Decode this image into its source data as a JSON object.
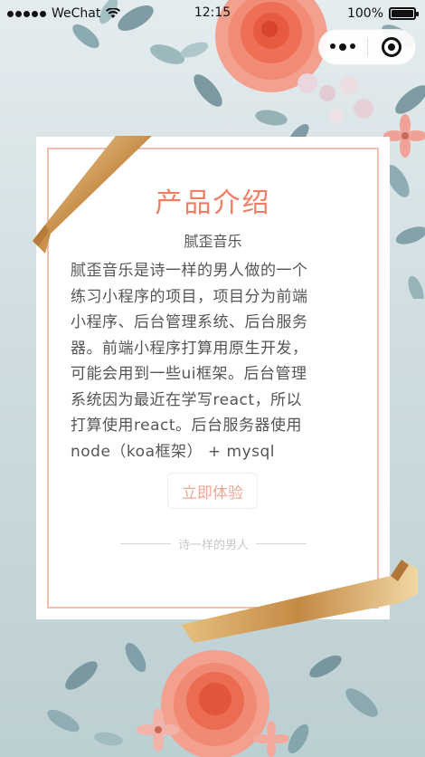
{
  "status_bar": {
    "carrier": "WeChat",
    "time": "12:15",
    "battery": "100%"
  },
  "capsule": {
    "more_icon": "more-dots-icon",
    "close_icon": "close-mini-program-icon"
  },
  "card": {
    "title": "产品介绍",
    "subtitle": "腻歪音乐",
    "body_lines": [
      "腻歪音乐是诗一样的男人做的一个",
      "练习小程序的项目，项目分为前端",
      "小程序、后台管理系统、后台服务",
      "器。前端小程序打算用原生开发，",
      "可能会用到一些ui框架。后台管理",
      "系统因为最近在学写react，所以",
      "打算使用react。后台服务器使用",
      "node（koa框架） + mysql"
    ],
    "cta_label": "立即体验",
    "signature": "诗一样的男人"
  },
  "colors": {
    "accent": "#f07e66",
    "frame": "#f2bdb3",
    "background_top": "#e4ecef",
    "background_bottom": "#bccfd3"
  }
}
